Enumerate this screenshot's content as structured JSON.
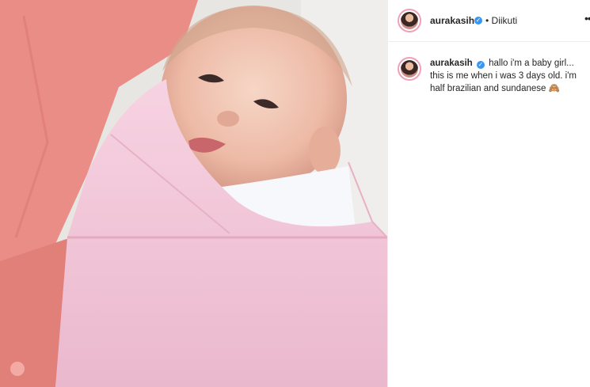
{
  "header": {
    "username": "aurakasih",
    "follow_status": "• Diikuti",
    "more_icon": "ellipsis-icon",
    "verified_icon": "check"
  },
  "comment": {
    "username": "aurakasih",
    "text": "hallo i'm a baby girl... this is me when i was 3 days old. i'm half brazilian and sundanese 🙈"
  },
  "colors": {
    "verified": "#3897f0",
    "towel": "#f4c9dc",
    "shirt": "#e98a84"
  }
}
